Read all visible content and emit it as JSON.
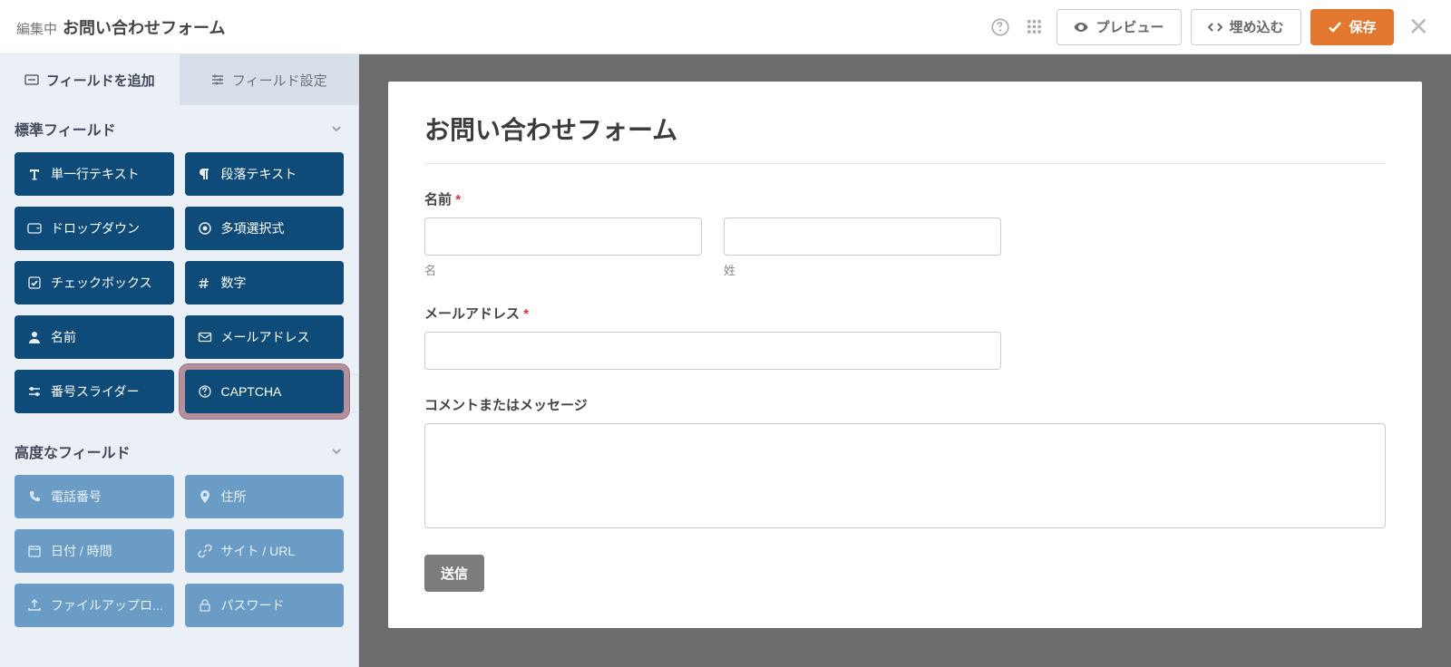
{
  "header": {
    "editing_label": "編集中",
    "title": "お問い合わせフォーム",
    "preview": "プレビュー",
    "embed": "埋め込む",
    "save": "保存"
  },
  "sidebar": {
    "tabs": {
      "add": "フィールドを追加",
      "settings": "フィールド設定"
    },
    "standard_header": "標準フィールド",
    "standard": [
      {
        "icon": "text-icon",
        "label": "単一行テキスト"
      },
      {
        "icon": "paragraph-icon",
        "label": "段落テキスト"
      },
      {
        "icon": "dropdown-icon",
        "label": "ドロップダウン"
      },
      {
        "icon": "radio-icon",
        "label": "多項選択式"
      },
      {
        "icon": "checkbox-icon",
        "label": "チェックボックス"
      },
      {
        "icon": "number-icon",
        "label": "数字"
      },
      {
        "icon": "person-icon",
        "label": "名前"
      },
      {
        "icon": "email-icon",
        "label": "メールアドレス"
      },
      {
        "icon": "slider-icon",
        "label": "番号スライダー"
      },
      {
        "icon": "captcha-icon",
        "label": "CAPTCHA"
      }
    ],
    "advanced_header": "高度なフィールド",
    "advanced": [
      {
        "icon": "phone-icon",
        "label": "電話番号"
      },
      {
        "icon": "address-icon",
        "label": "住所"
      },
      {
        "icon": "date-icon",
        "label": "日付 / 時間"
      },
      {
        "icon": "link-icon",
        "label": "サイト / URL"
      },
      {
        "icon": "upload-icon",
        "label": "ファイルアップロ..."
      },
      {
        "icon": "password-icon",
        "label": "パスワード"
      }
    ]
  },
  "form": {
    "title": "お問い合わせフォーム",
    "name_label": "名前",
    "first_sub": "名",
    "last_sub": "姓",
    "email_label": "メールアドレス",
    "comment_label": "コメントまたはメッセージ",
    "submit": "送信"
  }
}
